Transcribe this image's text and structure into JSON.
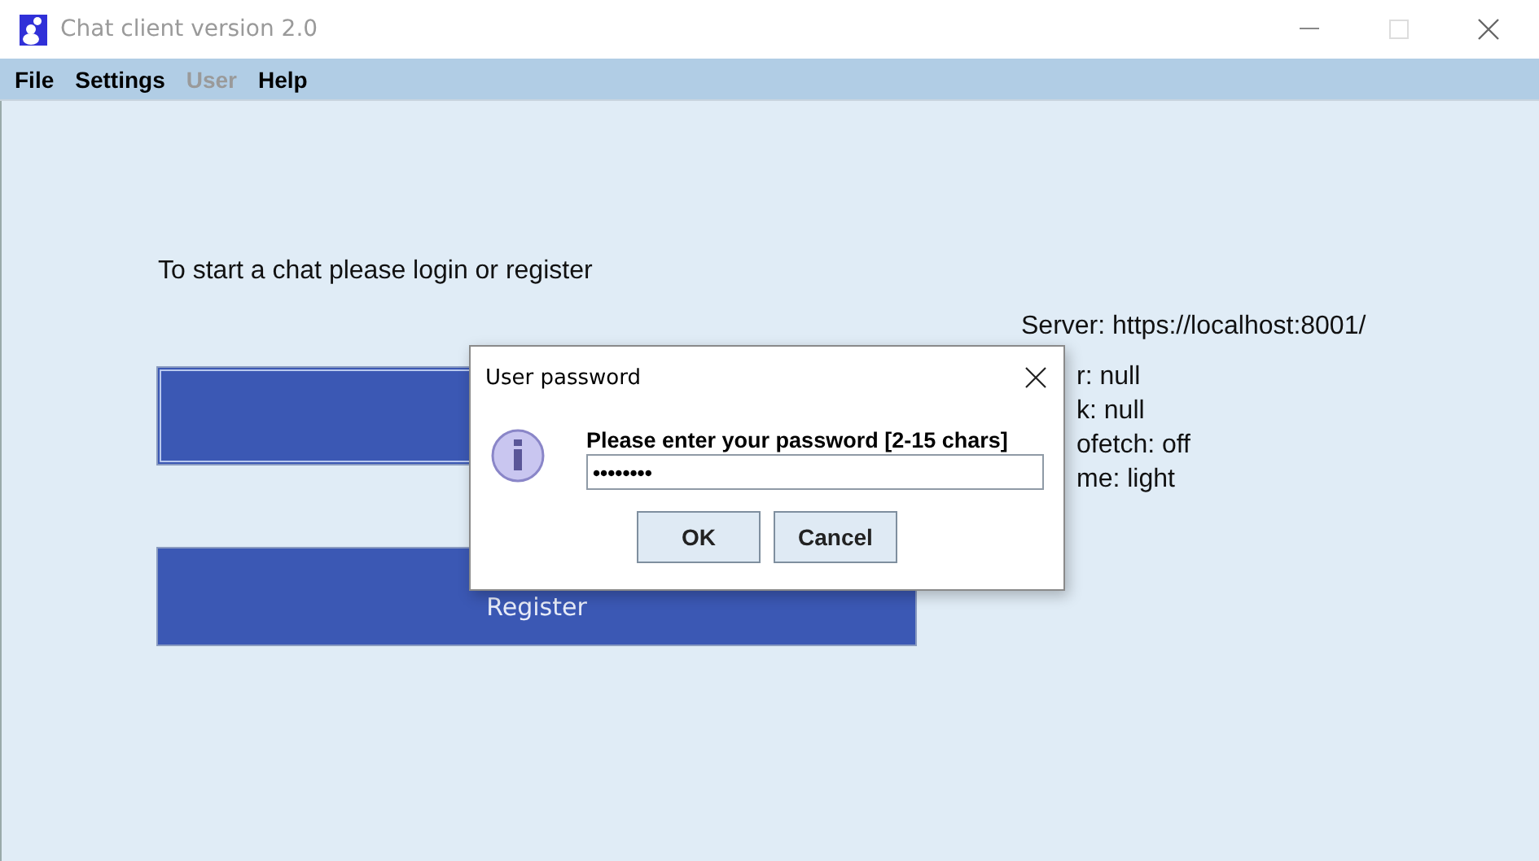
{
  "window": {
    "title": "Chat client version 2.0"
  },
  "menu": [
    {
      "label": "File",
      "disabled": false
    },
    {
      "label": "Settings",
      "disabled": false
    },
    {
      "label": "User",
      "disabled": true
    },
    {
      "label": "Help",
      "disabled": false
    }
  ],
  "prompt": "To start a chat please login or register",
  "main_buttons": [
    {
      "focused": true
    },
    {
      "label": "Register",
      "focused": false
    }
  ],
  "info_lines": [
    "Server: https://localhost:8001/",
    "r: null",
    "k: null",
    "ofetch: off",
    "me: light"
  ],
  "dialog": {
    "title": "User password",
    "message": "Please enter your password [2-15 chars]",
    "value": "••••••••",
    "buttons": [
      "OK",
      "Cancel"
    ]
  }
}
